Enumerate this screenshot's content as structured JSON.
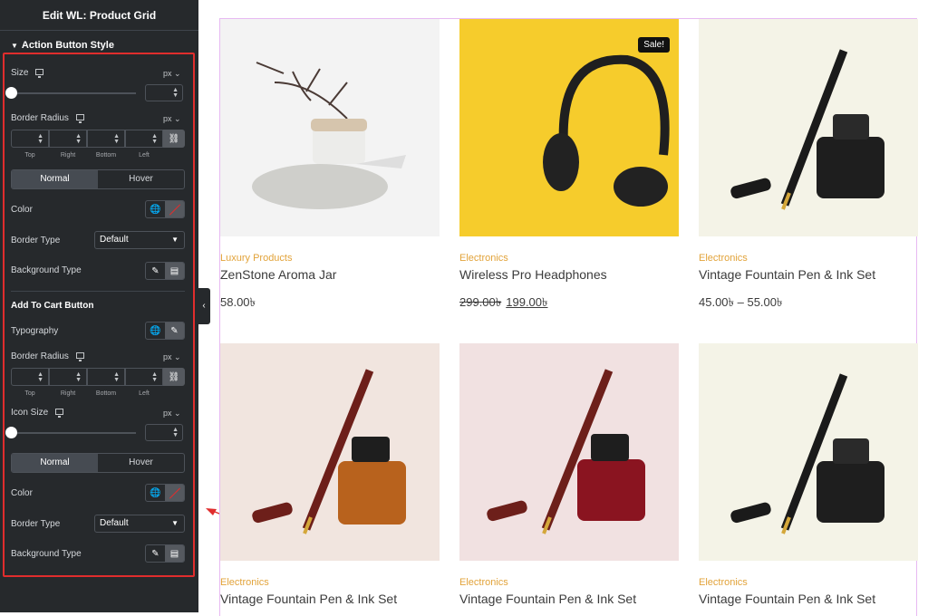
{
  "panel": {
    "title": "Edit WL: Product Grid",
    "section": "Action Button Style",
    "size_label": "Size",
    "unit": "px",
    "border_radius_label": "Border Radius",
    "dims": [
      "Top",
      "Right",
      "Bottom",
      "Left"
    ],
    "tab_normal": "Normal",
    "tab_hover": "Hover",
    "color_label": "Color",
    "border_type_label": "Border Type",
    "border_type_value": "Default",
    "bg_type_label": "Background Type",
    "add_to_cart_title": "Add To Cart Button",
    "typography_label": "Typography",
    "icon_size_label": "Icon Size"
  },
  "products": [
    {
      "category": "Luxury Products",
      "name": "ZenStone Aroma Jar",
      "price": "58.00৳",
      "old_price": "",
      "badge": ""
    },
    {
      "category": "Electronics",
      "name": "Wireless Pro Headphones",
      "price": "199.00৳",
      "old_price": "299.00৳",
      "badge": "Sale!"
    },
    {
      "category": "Electronics",
      "name": "Vintage Fountain Pen & Ink Set",
      "price": "45.00৳ – 55.00৳",
      "old_price": "",
      "badge": ""
    },
    {
      "category": "Electronics",
      "name": "Vintage Fountain Pen & Ink Set",
      "price": "",
      "old_price": "",
      "badge": ""
    },
    {
      "category": "Electronics",
      "name": "Vintage Fountain Pen & Ink Set",
      "price": "",
      "old_price": "",
      "badge": ""
    },
    {
      "category": "Electronics",
      "name": "Vintage Fountain Pen & Ink Set",
      "price": "",
      "old_price": "",
      "badge": ""
    }
  ],
  "colors": {
    "accent": "#e2a33a",
    "highlight": "#e02d2d",
    "panel_bg": "#26292c"
  },
  "icons": [
    "chevron-down-icon",
    "monitor-icon",
    "link-icon",
    "globe-icon",
    "brush-icon",
    "gradient-icon",
    "pencil-icon",
    "chevron-left-icon"
  ]
}
